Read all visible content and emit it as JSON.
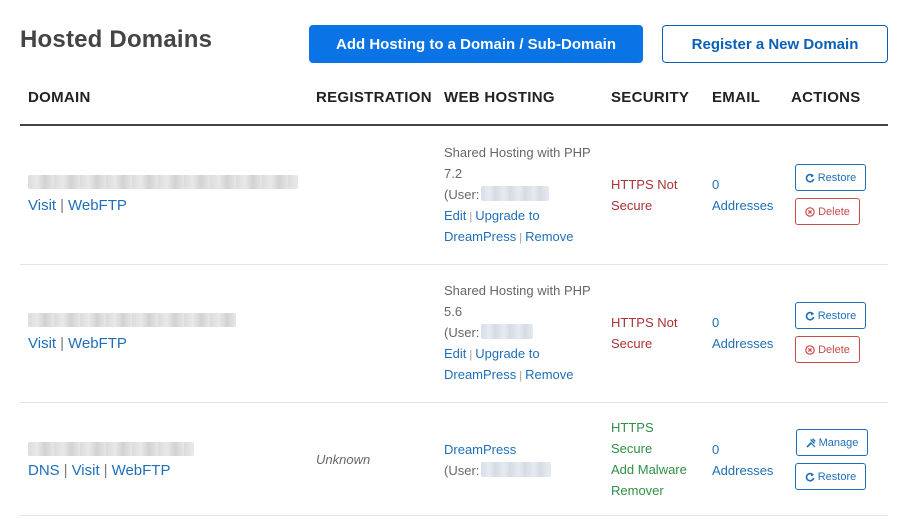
{
  "page": {
    "title": "Hosted Domains",
    "add_hosting_label": "Add Hosting to a Domain / Sub-Domain",
    "register_label": "Register a New Domain"
  },
  "table": {
    "headers": [
      "DOMAIN",
      "REGISTRATION",
      "WEB HOSTING",
      "SECURITY",
      "EMAIL",
      "ACTIONS"
    ],
    "rows": [
      {
        "domain_links": [
          "Visit",
          "WebFTP"
        ],
        "registration": "",
        "hosting": {
          "line1": "Shared Hosting with PHP",
          "line2": "7.2",
          "user_prefix": "(User:",
          "edit": "Edit",
          "upgrade": "Upgrade to",
          "dreampress": "DreamPress",
          "remove": "Remove"
        },
        "security": [
          "HTTPS Not",
          "Secure"
        ],
        "email": [
          "0",
          "Addresses"
        ],
        "actions": [
          "Restore",
          "Delete"
        ]
      },
      {
        "domain_links": [
          "Visit",
          "WebFTP"
        ],
        "registration": "",
        "hosting": {
          "line1": "Shared Hosting with PHP",
          "line2": "5.6",
          "user_prefix": "(User:",
          "edit": "Edit",
          "upgrade": "Upgrade to",
          "dreampress": "DreamPress",
          "remove": "Remove"
        },
        "security": [
          "HTTPS Not",
          "Secure"
        ],
        "email": [
          "0",
          "Addresses"
        ],
        "actions": [
          "Restore",
          "Delete"
        ]
      },
      {
        "domain_links": [
          "DNS",
          "Visit",
          "WebFTP"
        ],
        "registration": "Unknown",
        "hosting": {
          "line1": "DreamPress",
          "user_prefix": "(User:"
        },
        "security": [
          "HTTPS",
          "Secure",
          "Add Malware",
          "Remover"
        ],
        "email": [
          "0",
          "Addresses"
        ],
        "actions": [
          "Manage",
          "Restore"
        ]
      }
    ]
  },
  "colors": {
    "primary": "#0a73e6",
    "link": "#1f6fb8",
    "danger": "#a33",
    "success": "#2f8f45"
  }
}
